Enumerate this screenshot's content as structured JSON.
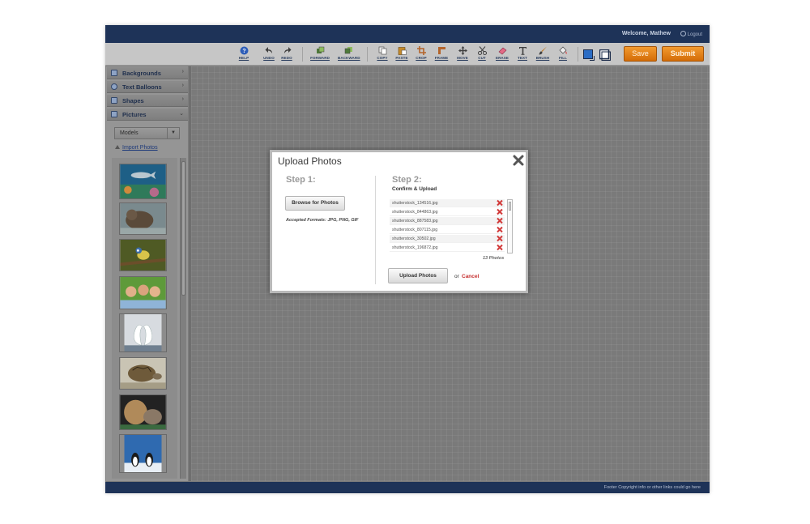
{
  "header": {
    "welcome": "Welcome, Mathew",
    "logout": "Logout"
  },
  "toolbar": {
    "tools": [
      {
        "id": "help",
        "label": "HELP",
        "icon": "help-icon"
      },
      {
        "id": "undo",
        "label": "UNDO",
        "icon": "undo-icon"
      },
      {
        "id": "redo",
        "label": "REDO",
        "icon": "redo-icon"
      },
      {
        "id": "forward",
        "label": "FORWARD",
        "icon": "forward-icon"
      },
      {
        "id": "backward",
        "label": "BACKWARD",
        "icon": "backward-icon"
      },
      {
        "id": "copy",
        "label": "COPY",
        "icon": "copy-icon"
      },
      {
        "id": "paste",
        "label": "PASTE",
        "icon": "paste-icon"
      },
      {
        "id": "crop",
        "label": "CROP",
        "icon": "crop-icon"
      },
      {
        "id": "frame",
        "label": "FRAME",
        "icon": "frame-icon"
      },
      {
        "id": "move",
        "label": "MOVE",
        "icon": "move-icon"
      },
      {
        "id": "cut",
        "label": "CUT",
        "icon": "scissors-icon"
      },
      {
        "id": "erase",
        "label": "ERASE",
        "icon": "eraser-icon"
      },
      {
        "id": "text",
        "label": "TEXT",
        "icon": "text-icon"
      },
      {
        "id": "brush",
        "label": "BRUSH",
        "icon": "brush-icon"
      },
      {
        "id": "fill",
        "label": "FILL",
        "icon": "fill-bucket-icon"
      }
    ],
    "save_label": "Save",
    "submit_label": "Submit"
  },
  "sidebar": {
    "items": [
      {
        "label": "Backgrounds",
        "icon": "backgrounds-icon"
      },
      {
        "label": "Text Balloons",
        "icon": "text-balloon-icon"
      },
      {
        "label": "Shapes",
        "icon": "shapes-icon"
      },
      {
        "label": "Pictures",
        "icon": "pictures-icon"
      }
    ],
    "category_select": "Models",
    "import_link": "Import Photos"
  },
  "modal": {
    "title": "Upload Photos",
    "step1": {
      "heading": "Step 1:",
      "browse_label": "Browse for Photos",
      "formats": "Accepted Formats: JPG, PNG, GIF"
    },
    "step2": {
      "heading": "Step 2:",
      "subheading": "Confirm & Upload",
      "files": [
        "shutterstock_134516.jpg",
        "shutterstock_844863.jpg",
        "shutterstock_887583.jpg",
        "shutterstock_807115.jpg",
        "shutterstock_30502.jpg",
        "shutterstock_196872.jpg"
      ],
      "count": "13 Photos",
      "upload_label": "Upload Photos",
      "or": "or",
      "cancel": "Cancel"
    }
  },
  "footer": {
    "text": "Footer Copyright info or other links could go here"
  },
  "colors": {
    "header": "#1e3358",
    "accent": "#e8820f",
    "cancel": "#c62f2f"
  }
}
